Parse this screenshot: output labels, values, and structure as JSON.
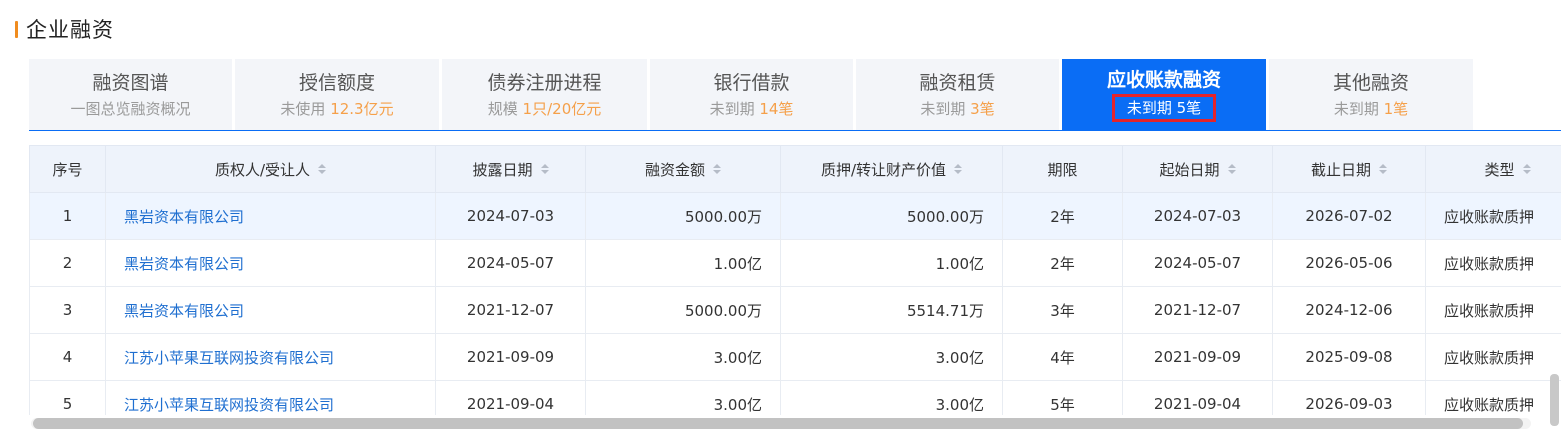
{
  "section": {
    "title": "企业融资",
    "accent_color": "#f08c1f"
  },
  "tabs": [
    {
      "label": "融资图谱",
      "sub_prefix": "一图总览融资概况",
      "sub_highlight": ""
    },
    {
      "label": "授信额度",
      "sub_prefix": "未使用 ",
      "sub_highlight": "12.3亿元"
    },
    {
      "label": "债券注册进程",
      "sub_prefix": "规模 ",
      "sub_highlight": "1只/20亿元"
    },
    {
      "label": "银行借款",
      "sub_prefix": "未到期 ",
      "sub_highlight": "14笔"
    },
    {
      "label": "融资租赁",
      "sub_prefix": "未到期 ",
      "sub_highlight": "3笔"
    },
    {
      "label": "应收账款融资",
      "sub_prefix": "未到期 ",
      "sub_highlight": "5笔",
      "active": true
    },
    {
      "label": "其他融资",
      "sub_prefix": "未到期 ",
      "sub_highlight": "1笔"
    }
  ],
  "table": {
    "headers": [
      "序号",
      "质权人/受让人",
      "披露日期",
      "融资金额",
      "质押/转让财产价值",
      "期限",
      "起始日期",
      "截止日期",
      "类型"
    ],
    "rows": [
      [
        "1",
        "黑岩资本有限公司",
        "2024-07-03",
        "5000.00万",
        "5000.00万",
        "2年",
        "2024-07-03",
        "2026-07-02",
        "应收账款质押"
      ],
      [
        "2",
        "黑岩资本有限公司",
        "2024-05-07",
        "1.00亿",
        "1.00亿",
        "2年",
        "2024-05-07",
        "2026-05-06",
        "应收账款质押"
      ],
      [
        "3",
        "黑岩资本有限公司",
        "2021-12-07",
        "5000.00万",
        "5514.71万",
        "3年",
        "2021-12-07",
        "2024-12-06",
        "应收账款质押"
      ],
      [
        "4",
        "江苏小苹果互联网投资有限公司",
        "2021-09-09",
        "3.00亿",
        "3.00亿",
        "4年",
        "2021-09-09",
        "2025-09-08",
        "应收账款质押"
      ],
      [
        "5",
        "江苏小苹果互联网投资有限公司",
        "2021-09-04",
        "3.00亿",
        "3.00亿",
        "5年",
        "2021-09-04",
        "2026-09-03",
        "应收账款质押"
      ]
    ]
  },
  "colors": {
    "active_tab": "#0a6df5",
    "highlight_text": "#f5a04a",
    "link": "#1f6fd0",
    "active_outline": "#e3242b"
  }
}
